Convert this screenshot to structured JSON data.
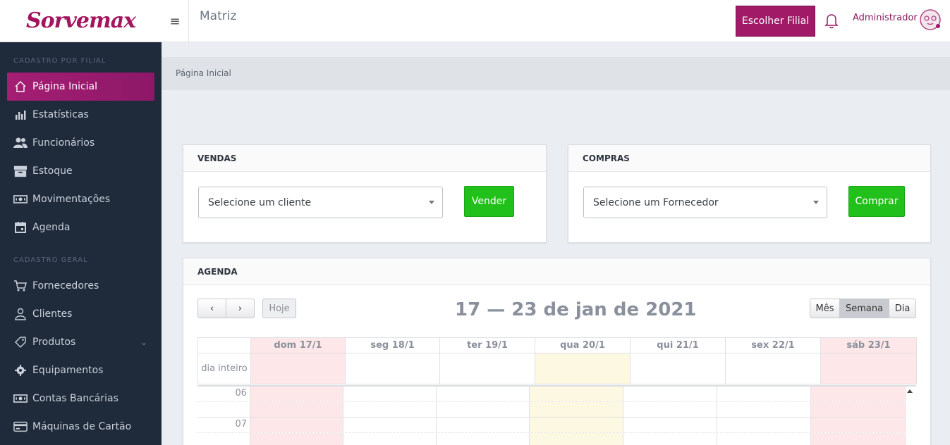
{
  "brand": {
    "logo_text": "Sorvemax",
    "accent": "#a01a68",
    "sidebar_bg": "#1f2a3a"
  },
  "topbar": {
    "title": "Matriz",
    "choose_branch": "Escolher Filial",
    "user": "Administrador"
  },
  "breadcrumb": "Página Inicial",
  "sidebar": {
    "section_branch": "CADASTRO POR FILIAL",
    "items_branch": [
      {
        "label": "Página Inicial",
        "icon": "home-icon"
      },
      {
        "label": "Estatísticas",
        "icon": "bar-chart-icon"
      },
      {
        "label": "Funcionários",
        "icon": "users-icon"
      },
      {
        "label": "Estoque",
        "icon": "box-icon"
      },
      {
        "label": "Movimentações",
        "icon": "money-icon"
      },
      {
        "label": "Agenda",
        "icon": "calendar-icon"
      }
    ],
    "section_general": "CADASTRO GERAL",
    "items_general": [
      {
        "label": "Fornecedores",
        "icon": "cart-icon"
      },
      {
        "label": "Clientes",
        "icon": "user-icon"
      },
      {
        "label": "Produtos",
        "icon": "tag-icon"
      },
      {
        "label": "Equipamentos",
        "icon": "gear-icon"
      },
      {
        "label": "Contas Bancárias",
        "icon": "money-icon"
      },
      {
        "label": "Máquinas de Cartão",
        "icon": "card-icon"
      }
    ]
  },
  "sales": {
    "title": "VENDAS",
    "select_placeholder": "Selecione um cliente",
    "button": "Vender"
  },
  "purchases": {
    "title": "COMPRAS",
    "select_placeholder": "Selecione um Fornecedor",
    "button": "Comprar"
  },
  "agenda": {
    "title": "AGENDA",
    "prev": "‹",
    "next": "›",
    "today": "Hoje",
    "range_title": "17 — 23 de jan de 2021",
    "views": [
      "Mês",
      "Semana",
      "Dia"
    ],
    "active_view": "Semana",
    "days": [
      "dom 17/1",
      "seg 18/1",
      "ter 19/1",
      "qua 20/1",
      "qui 21/1",
      "sex 22/1",
      "sáb 23/1"
    ],
    "all_day_label": "dia inteiro",
    "hours": [
      "06",
      "07"
    ]
  }
}
